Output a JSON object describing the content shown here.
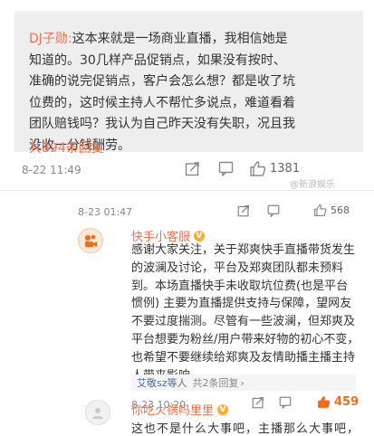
{
  "comment1": {
    "user": "DJ子勋:",
    "text": "这本来就是一场商业直播，我相信她是知道的。30几样产品促销点，如果没有按时、准确的说完促销点，客户会怎么想？都是收了坑位费的，这时候主持人不帮忙多说点，难道看着团队赔钱吗？我认为自己昨天没有失职，况且我没收一分钱酬劳。",
    "more_replies": "共894条回复",
    "time": "8-22 11:49",
    "likes": "1381",
    "watermark": "@新浪娱乐"
  },
  "comment2": {
    "time": "8-23 01:47",
    "likes": "568"
  },
  "comment3": {
    "user": "快手小客服",
    "text": "感谢大家关注，关于郑爽快手直播带货发生的波澜及讨论，平台及郑爽团队都未预料到。本场直播快手未收取坑位费(也是平台惯例) 主要为直播提供支持与保障，望网友不要过度揣测。尽管有一些波澜，但郑爽及平台想要为粉丝/用户带来好物的初心不变，也希望不要继续给郑爽及友情助播主播主持人带来影响。",
    "replies_link": "艾敬sz等人",
    "replies_count": "共2条回复",
    "time": "8-23 10:20",
    "likes": "459"
  },
  "comment4": {
    "user": "你吃火锅吗里里",
    "partial_text": "这也不是什么大事吧，主播那么大事吧，推荐是"
  },
  "colors": {
    "accent": "#eb7350",
    "hot": "#f26b1d",
    "link": "#4b6ca8"
  }
}
